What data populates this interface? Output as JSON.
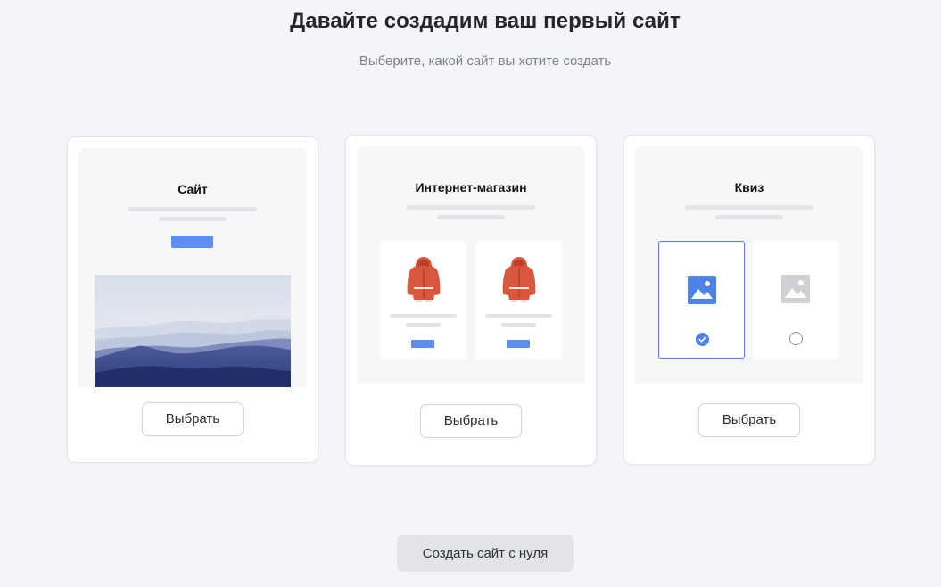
{
  "header": {
    "title": "Давайте создадим ваш первый сайт",
    "subtitle": "Выберите, какой сайт вы хотите создать"
  },
  "cards": [
    {
      "preview_title": "Сайт",
      "button_label": "Выбрать"
    },
    {
      "preview_title": "Интернет-магазин",
      "button_label": "Выбрать"
    },
    {
      "preview_title": "Квиз",
      "button_label": "Выбрать"
    }
  ],
  "footer": {
    "scratch_button_label": "Создать сайт с нуля"
  },
  "colors": {
    "accent": "#5b8ef0",
    "quiz_selected": "#4e82e8",
    "page_background": "#f4f5f8"
  },
  "icons": {
    "site_preview": "landscape-illustration",
    "shop_product": "red-jacket-image",
    "quiz_selected": "image-icon-blue",
    "quiz_unselected": "image-icon-grey"
  }
}
